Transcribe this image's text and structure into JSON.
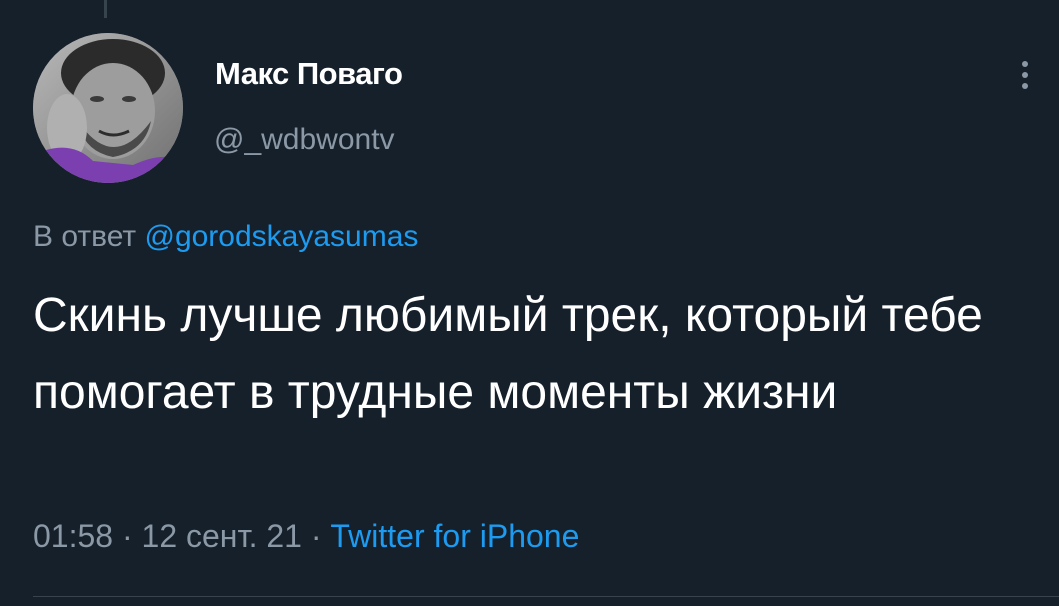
{
  "user": {
    "display_name": "Макс Поваго",
    "handle": "@_wdbwontv"
  },
  "reply": {
    "prefix": "В ответ",
    "mention": "@gorodskayasumas"
  },
  "tweet": {
    "text": "Скинь лучше любимый трек, который тебе помогает в трудные моменты жизни"
  },
  "meta": {
    "time": "01:58",
    "separator": "·",
    "date": "12 сент. 21",
    "source": "Twitter for iPhone"
  },
  "icons": {
    "more": "more-vertical-icon",
    "avatar": "avatar-photo"
  },
  "colors": {
    "background": "#15202b",
    "primary_text": "#ffffff",
    "secondary_text": "#8b98a5",
    "accent": "#1d9bf0"
  }
}
